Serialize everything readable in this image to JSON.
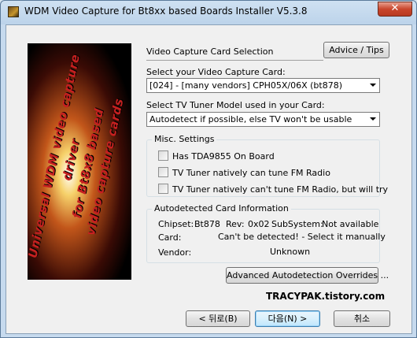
{
  "window": {
    "title": "WDM Video Capture for Bt8xx based Boards Installer V5.3.8",
    "close_glyph": "✕"
  },
  "banner": {
    "lines": [
      "Universal WDM video capture driver",
      "for Bt8x8 based",
      "video capture cards"
    ]
  },
  "section": {
    "title": "Video Capture Card Selection",
    "advice_button": "Advice / Tips"
  },
  "card": {
    "label": "Select your Video Capture Card:",
    "value": "[024] - [many vendors] CPH05X/06X (bt878)"
  },
  "tuner": {
    "label": "Select TV Tuner Model used in your Card:",
    "value": "Autodetect if possible, else TV won't be usable"
  },
  "misc": {
    "title": "Misc. Settings",
    "options": [
      {
        "label": "Has TDA9855 On Board",
        "checked": false
      },
      {
        "label": "TV Tuner natively can tune FM Radio",
        "checked": false
      },
      {
        "label": "TV Tuner natively can't tune FM Radio, but will try",
        "checked": false
      }
    ]
  },
  "autodetect": {
    "title": "Autodetected Card Information",
    "chipset_label": "Chipset:",
    "chipset_value": "Bt878",
    "rev_label": "Rev:",
    "rev_value": "0x02",
    "subsystem_label": "SubSystem:",
    "subsystem_value": "Not available",
    "card_label": "Card:",
    "card_value": "Can't be detected! - Select it manually",
    "vendor_label": "Vendor:",
    "vendor_value": "Unknown",
    "overrides_button": "Advanced Autodetection Overrides ..."
  },
  "footer": {
    "watermark": "TRACYPAK.tistory.com",
    "back_button": "< 뒤로(B)",
    "next_button": "다음(N) >",
    "cancel_button": "취소"
  }
}
